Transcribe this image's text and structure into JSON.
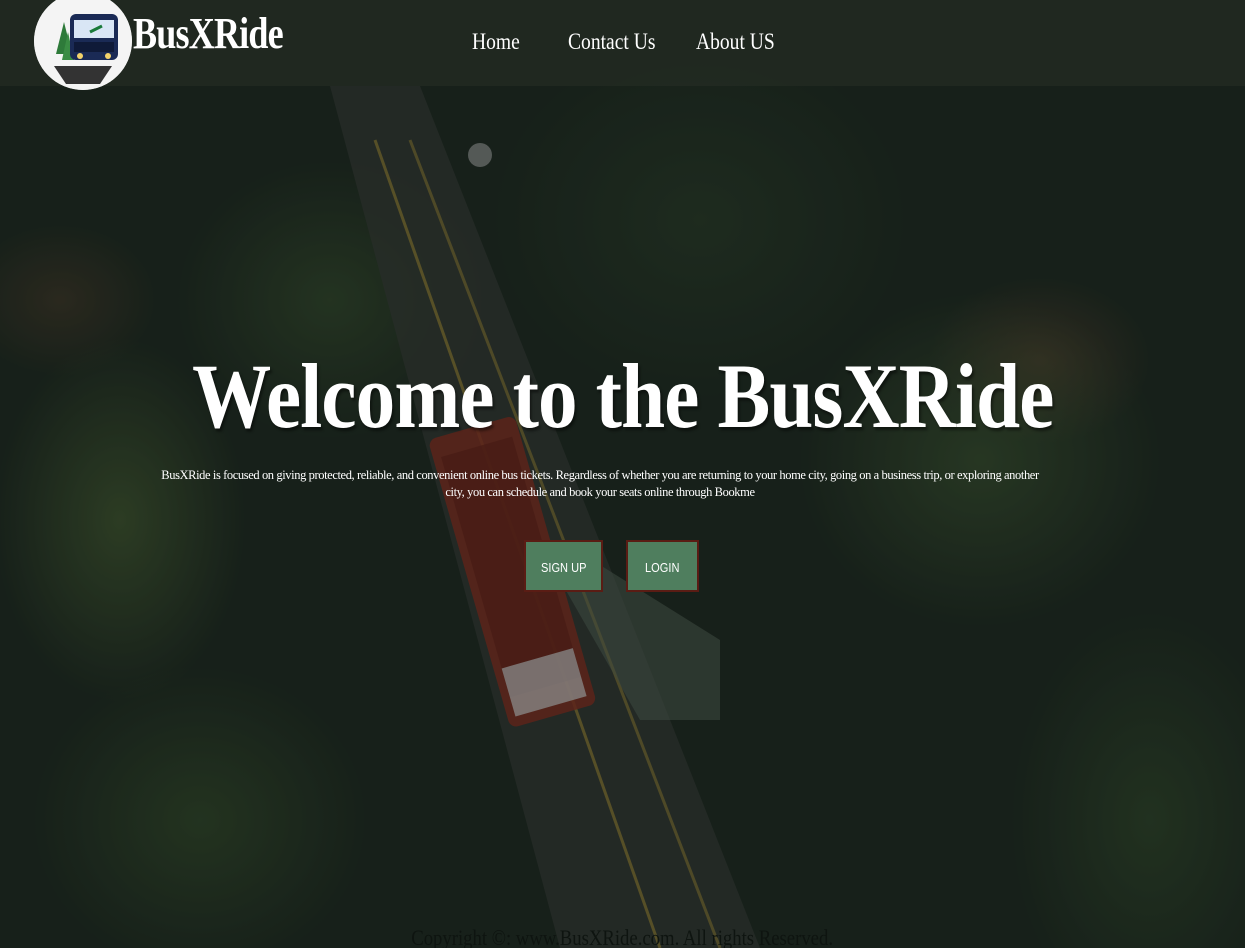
{
  "brand": {
    "name": "BusXRide",
    "logo_icon": "bus-logo-icon"
  },
  "nav": {
    "home": "Home",
    "contact": "Contact Us",
    "about": "About US"
  },
  "hero": {
    "title": "Welcome to the BusXRide",
    "description": "BusXRide is focused on giving protected, reliable, and convenient online bus tickets. Regardless of whether you are returning to your home city, going on a business trip, or exploring another city, you can schedule and book your seats online through Bookme",
    "signup_label": "SIGN UP",
    "login_label": "LOGIN"
  },
  "footer": {
    "copyright": "Copyright ©: www.BusXRide.com. All rights Reserved."
  },
  "colors": {
    "button_bg": "#4f7e5e",
    "button_border": "#5a1c14",
    "nav_bg": "rgba(40,48,38,0.55)",
    "text": "#ffffff"
  }
}
